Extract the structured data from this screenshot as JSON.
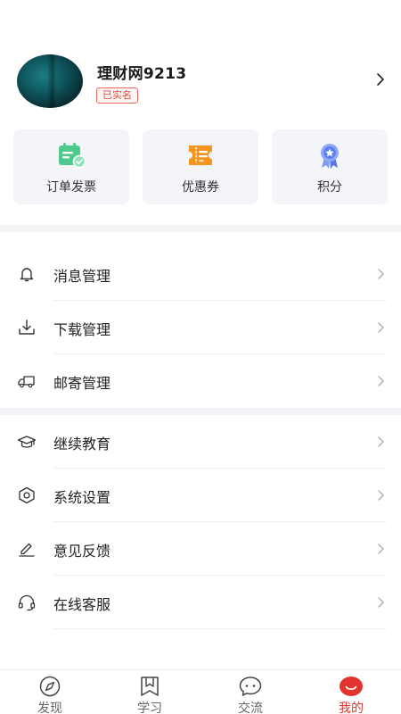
{
  "profile": {
    "username": "理财网9213",
    "verify_badge": "已实名"
  },
  "quick_actions": [
    {
      "label": "订单发票",
      "icon": "invoice-icon",
      "color": "#4ecb8c"
    },
    {
      "label": "优惠券",
      "icon": "coupon-icon",
      "color": "#f7941d"
    },
    {
      "label": "积分",
      "icon": "points-medal-icon",
      "color": "#6f8ff2"
    }
  ],
  "menu_group_1": [
    {
      "label": "消息管理",
      "icon": "bell-icon"
    },
    {
      "label": "下载管理",
      "icon": "download-icon"
    },
    {
      "label": "邮寄管理",
      "icon": "delivery-truck-icon"
    }
  ],
  "menu_group_2": [
    {
      "label": "继续教育",
      "icon": "graduation-cap-icon"
    },
    {
      "label": "系统设置",
      "icon": "settings-hexagon-icon"
    },
    {
      "label": "意见反馈",
      "icon": "edit-pen-icon"
    },
    {
      "label": "在线客服",
      "icon": "headset-icon"
    }
  ],
  "tabbar": {
    "items": [
      {
        "label": "发现",
        "icon": "compass-icon"
      },
      {
        "label": "学习",
        "icon": "book-icon"
      },
      {
        "label": "交流",
        "icon": "chat-bubble-icon"
      },
      {
        "label": "我的",
        "icon": "profile-face-icon"
      }
    ],
    "active_index": 3,
    "active_color": "#e2342f"
  }
}
